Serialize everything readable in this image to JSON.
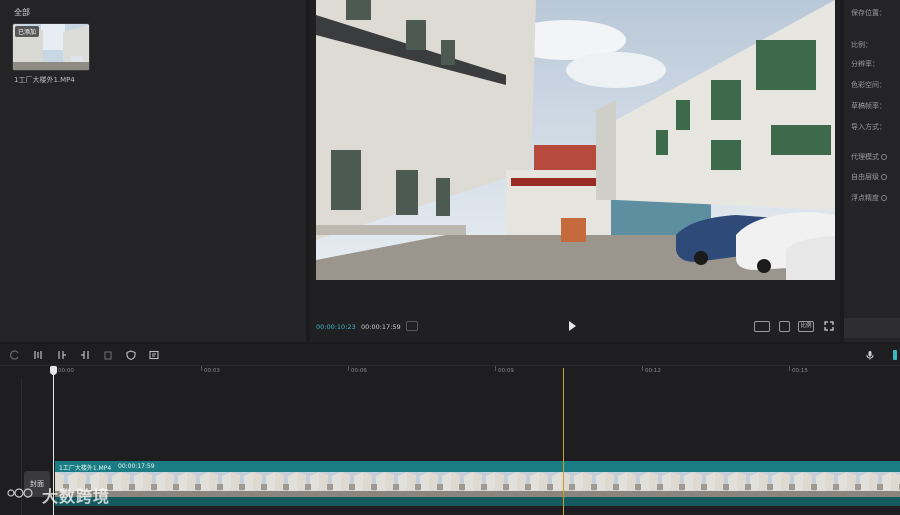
{
  "media": {
    "section_label": "全部",
    "items": [
      {
        "badge": "已添加",
        "filename": "1工厂大楼外1.MP4"
      }
    ]
  },
  "player": {
    "time_current": "00:00:10:23",
    "time_total": "00:00:17:59",
    "controls": [
      "frame-compare-icon",
      "play-icon",
      "fullscreen-icon",
      "zoom-icon"
    ],
    "ratio_label": "比例"
  },
  "properties": {
    "labels": [
      "保存位置：",
      "比例：",
      "分辨率：",
      "色彩空间：",
      "草稿帧率：",
      "导入方式：",
      "代理模式",
      "自由层级",
      "浮点精度"
    ]
  },
  "timeline": {
    "ruler_ticks": [
      "00:00",
      "00:03",
      "00:06",
      "00:09",
      "00:12",
      "00:15"
    ],
    "cover_label": "封面",
    "clip": {
      "name": "1工厂大楼外1.MP4",
      "duration": "00:00:17:59"
    }
  },
  "watermark": "大数跨境",
  "colors": {
    "accent": "#3fb6c4",
    "clip": "#1d6f74",
    "marker": "#c9a227"
  }
}
